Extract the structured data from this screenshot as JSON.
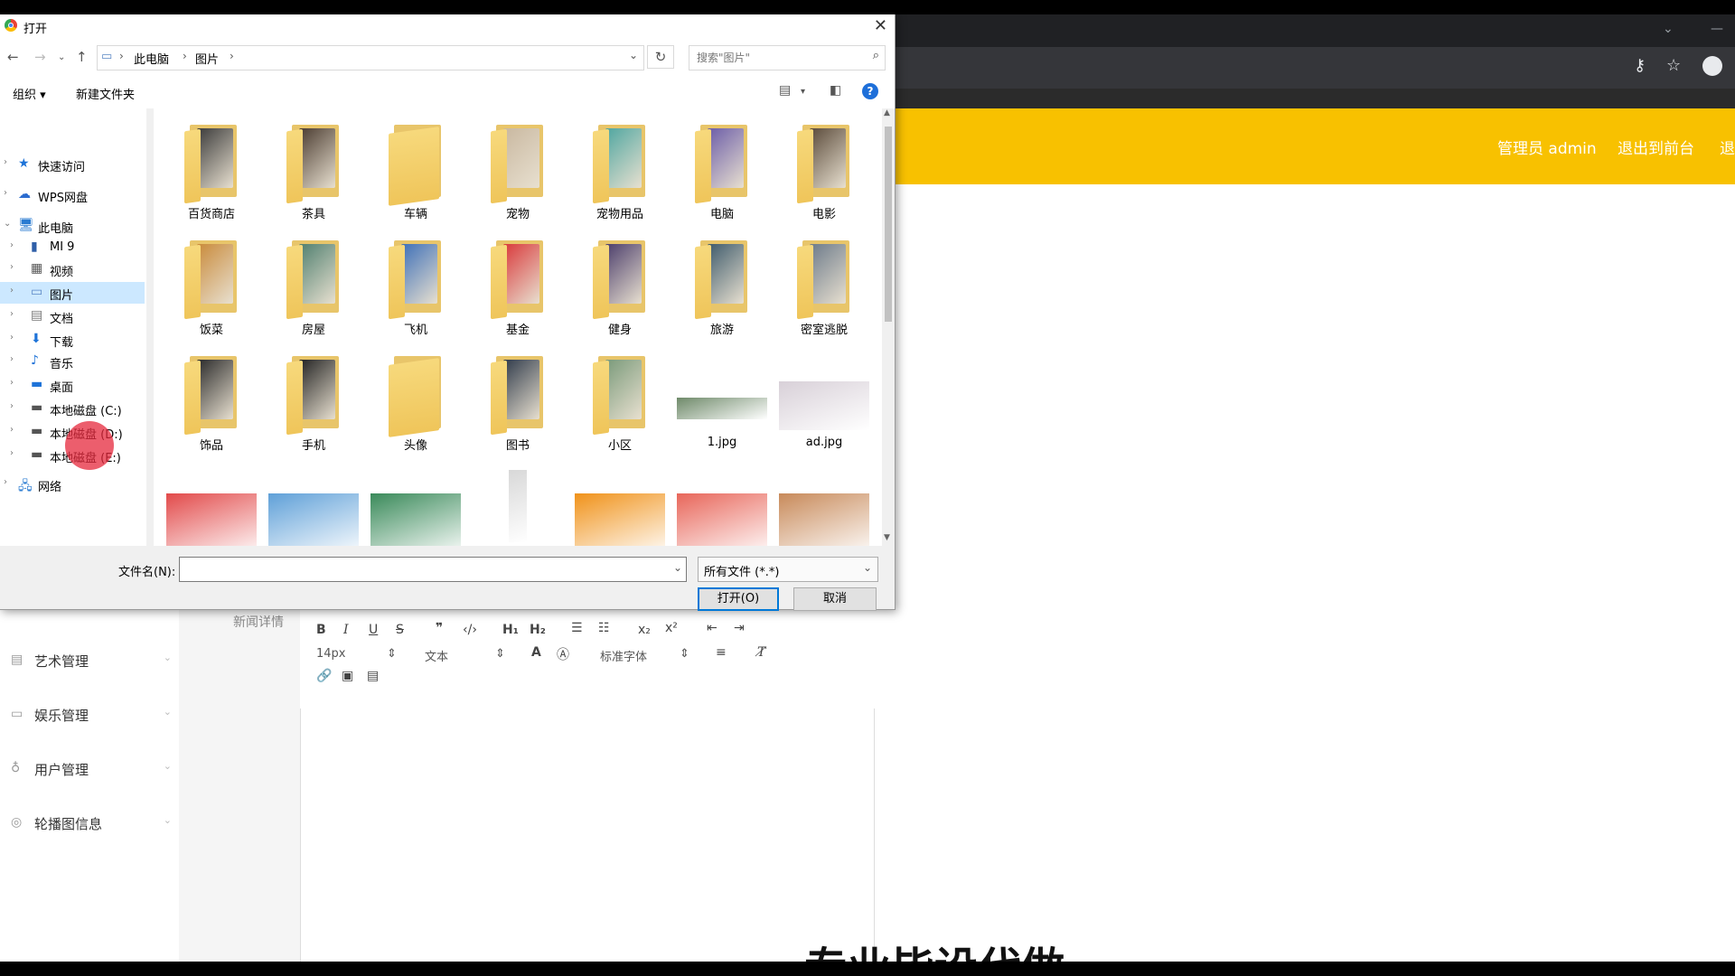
{
  "browser": {
    "header_links": [
      "管理员 admin",
      "退出到前台",
      "退"
    ]
  },
  "admin": {
    "sidebar": [
      {
        "label": "艺术管理",
        "icon": "clipboard-icon"
      },
      {
        "label": "娱乐管理",
        "icon": "chat-icon"
      },
      {
        "label": "用户管理",
        "icon": "mic-icon"
      },
      {
        "label": "轮播图信息",
        "icon": "compass-icon"
      }
    ],
    "editor_label": "新闻详情",
    "toolbar": {
      "font_size": "14px",
      "block": "文本",
      "font_family": "标准字体"
    },
    "bottom_text": "专业毕设代做"
  },
  "dialog": {
    "title": "打开",
    "breadcrumb": [
      "此电脑",
      "图片"
    ],
    "search_placeholder": "搜索\"图片\"",
    "organize": "组织 ▾",
    "new_folder": "新建文件夹",
    "nav": [
      {
        "label": "快速访问",
        "icon": "★",
        "color": "#1e73d8",
        "level": 0
      },
      {
        "label": "WPS网盘",
        "icon": "☁",
        "color": "#2b6ccf",
        "level": 0
      },
      {
        "label": "此电脑",
        "icon": "🖥",
        "color": "#2a7bd1",
        "level": 0,
        "expanded": true
      },
      {
        "label": "MI 9",
        "icon": "▮",
        "color": "#2f5fa8",
        "level": 1
      },
      {
        "label": "视频",
        "icon": "▦",
        "color": "#555",
        "level": 1
      },
      {
        "label": "图片",
        "icon": "▭",
        "color": "#5a87c5",
        "level": 1,
        "selected": true
      },
      {
        "label": "文档",
        "icon": "▤",
        "color": "#777",
        "level": 1
      },
      {
        "label": "下载",
        "icon": "⬇",
        "color": "#1e73d8",
        "level": 1
      },
      {
        "label": "音乐",
        "icon": "♪",
        "color": "#1e73d8",
        "level": 1
      },
      {
        "label": "桌面",
        "icon": "▬",
        "color": "#1e73d8",
        "level": 1
      },
      {
        "label": "本地磁盘 (C:)",
        "icon": "▬",
        "color": "#555",
        "level": 1
      },
      {
        "label": "本地磁盘 (D:)",
        "icon": "▬",
        "color": "#555",
        "level": 1
      },
      {
        "label": "本地磁盘 (E:)",
        "icon": "▬",
        "color": "#555",
        "level": 1
      },
      {
        "label": "网络",
        "icon": "🖧",
        "color": "#2a7bd1",
        "level": 0
      }
    ],
    "items": [
      {
        "name": "百货商店",
        "kind": "folder",
        "color": "#3a3a3a"
      },
      {
        "name": "茶具",
        "kind": "folder",
        "color": "#4a3b30"
      },
      {
        "name": "车辆",
        "kind": "folder",
        "color": ""
      },
      {
        "name": "宠物",
        "kind": "folder",
        "color": "#c9b8a0"
      },
      {
        "name": "宠物用品",
        "kind": "folder",
        "color": "#4fa6a0"
      },
      {
        "name": "电脑",
        "kind": "folder",
        "color": "#6b5ca8"
      },
      {
        "name": "电影",
        "kind": "folder",
        "color": "#5a4a3a"
      },
      {
        "name": "饭菜",
        "kind": "folder",
        "color": "#c98a3a"
      },
      {
        "name": "房屋",
        "kind": "folder",
        "color": "#4f7f6f"
      },
      {
        "name": "飞机",
        "kind": "folder",
        "color": "#3d6fb8"
      },
      {
        "name": "基金",
        "kind": "folder",
        "color": "#d9383a"
      },
      {
        "name": "健身",
        "kind": "folder",
        "color": "#4b3d6b"
      },
      {
        "name": "旅游",
        "kind": "folder",
        "color": "#3d5a6b"
      },
      {
        "name": "密室逃脱",
        "kind": "folder",
        "color": "#6c7a8a"
      },
      {
        "name": "饰品",
        "kind": "folder",
        "color": "#2a2a2a"
      },
      {
        "name": "手机",
        "kind": "folder",
        "color": "#222"
      },
      {
        "name": "头像",
        "kind": "folder",
        "color": ""
      },
      {
        "name": "图书",
        "kind": "folder",
        "color": "#2f3a4a"
      },
      {
        "name": "小区",
        "kind": "folder",
        "color": "#7a9a7a"
      },
      {
        "name": "1.jpg",
        "kind": "image",
        "color": "#6f8a6a"
      },
      {
        "name": "ad.jpg",
        "kind": "image",
        "color": "#d8d0d8"
      },
      {
        "name": "",
        "kind": "image",
        "color": "#e24a4a"
      },
      {
        "name": "",
        "kind": "image",
        "color": "#5fa0d8"
      },
      {
        "name": "",
        "kind": "image",
        "color": "#3a8a5a"
      },
      {
        "name": "",
        "kind": "image",
        "color": "#d8d8d8"
      },
      {
        "name": "",
        "kind": "image",
        "color": "#f0921a"
      },
      {
        "name": "",
        "kind": "image",
        "color": "#e8665a"
      },
      {
        "name": "",
        "kind": "image",
        "color": "#c88a5a"
      }
    ],
    "filename_label": "文件名(N):",
    "filename_value": "",
    "filetype": "所有文件 (*.*)",
    "open_label": "打开(O)",
    "cancel_label": "取消"
  }
}
